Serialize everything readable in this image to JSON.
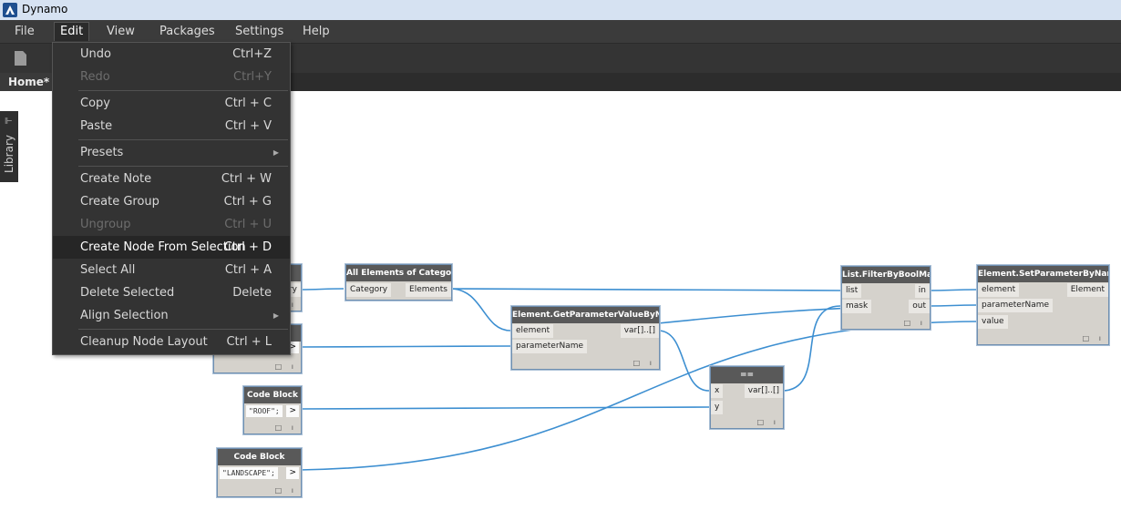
{
  "window": {
    "title": "Dynamo"
  },
  "menubar": {
    "items": [
      "File",
      "Edit",
      "View",
      "Packages",
      "Settings",
      "Help"
    ]
  },
  "tab": {
    "label": "Home*"
  },
  "library": {
    "label": "Library",
    "arrow": "⊩"
  },
  "edit_menu": {
    "items": [
      {
        "label": "Undo",
        "shortcut": "Ctrl+Z"
      },
      {
        "label": "Redo",
        "shortcut": "Ctrl+Y",
        "disabled": true
      },
      {
        "label": "Copy",
        "shortcut": "Ctrl + C"
      },
      {
        "label": "Paste",
        "shortcut": "Ctrl + V"
      },
      {
        "label": "Presets",
        "submenu": true
      },
      {
        "label": "Create Note",
        "shortcut": "Ctrl + W"
      },
      {
        "label": "Create Group",
        "shortcut": "Ctrl + G"
      },
      {
        "label": "Ungroup",
        "shortcut": "Ctrl + U",
        "disabled": true
      },
      {
        "label": "Create Node From Selection",
        "shortcut": "Ctrl + D",
        "highlighted": true
      },
      {
        "label": "Select All",
        "shortcut": "Ctrl + A"
      },
      {
        "label": "Delete Selected",
        "shortcut": "Delete"
      },
      {
        "label": "Align Selection",
        "submenu": true
      },
      {
        "label": "Cleanup Node Layout",
        "shortcut": "Ctrl + L"
      }
    ],
    "submenu_glyph": "▶"
  },
  "nodes": {
    "category_partial": {
      "out_text": "ory"
    },
    "string_partial": {
      "out_text": ">"
    },
    "all_elements": {
      "title": "All Elements of Category",
      "in": "Category",
      "out": "Elements"
    },
    "get_param": {
      "title": "Element.GetParameterValueByName",
      "in1": "element",
      "in2": "parameterName",
      "out": "var[]..[]"
    },
    "code_roof": {
      "title": "Code Block",
      "code": "\"ROOF\";",
      "out": ">"
    },
    "code_landscape": {
      "title": "Code Block",
      "code": "\"LANDSCAPE\";",
      "out": ">"
    },
    "equals": {
      "title": "==",
      "in1": "x",
      "in2": "y",
      "out": "var[]..[]"
    },
    "filter": {
      "title": "List.FilterByBoolMask",
      "in1": "list",
      "in2": "mask",
      "out1": "in",
      "out2": "out"
    },
    "set_param": {
      "title": "Element.SetParameterByName",
      "in1": "element",
      "in2": "parameterName",
      "in3": "value",
      "out": "Element"
    }
  },
  "colors": {
    "wire": "#3d8fd1",
    "menu_bg": "#333333",
    "menubar_bg": "#3b3b3b",
    "node_header": "#595959",
    "node_body": "#d5d2cc",
    "titlebar": "#d6e2f2"
  },
  "node_footer_glyph": "□ ı"
}
